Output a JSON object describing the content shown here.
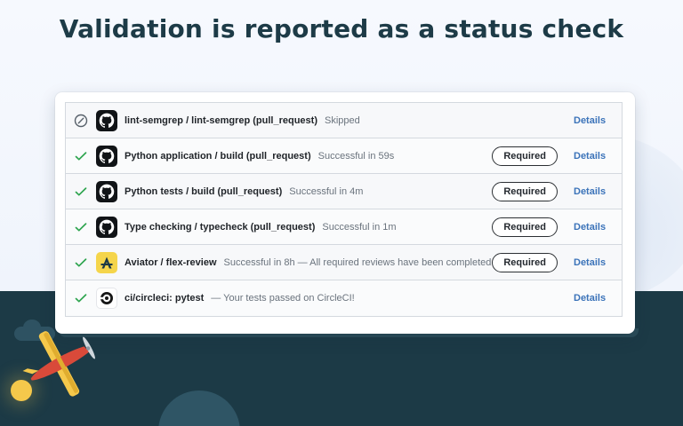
{
  "headline": "Validation is reported as a status check",
  "colors": {
    "dark_band": "#1c3a46",
    "success": "#2da44e",
    "link": "#3b73b9",
    "plane_yellow": "#f5c84b",
    "plane_red": "#d94a3a"
  },
  "checks": [
    {
      "status": "skipped",
      "status_icon": "skipped-icon",
      "avatar": "github-icon",
      "name": "lint-semgrep / lint-semgrep (pull_request)",
      "description": "Skipped",
      "required": "",
      "details": "Details"
    },
    {
      "status": "success",
      "status_icon": "check-icon",
      "avatar": "github-icon",
      "name": "Python application / build (pull_request)",
      "description": "Successful in 59s",
      "required": "Required",
      "details": "Details"
    },
    {
      "status": "success",
      "status_icon": "check-icon",
      "avatar": "github-icon",
      "name": "Python tests / build (pull_request)",
      "description": "Successful in 4m",
      "required": "Required",
      "details": "Details"
    },
    {
      "status": "success",
      "status_icon": "check-icon",
      "avatar": "github-icon",
      "name": "Type checking / typecheck (pull_request)",
      "description": "Successful in 1m",
      "required": "Required",
      "details": "Details"
    },
    {
      "status": "success",
      "status_icon": "check-icon",
      "avatar": "aviator-logo",
      "name": "Aviator / flex-review",
      "description": "Successful in 8h — All required reviews have been completed",
      "required": "Required",
      "details": "Details"
    },
    {
      "status": "success",
      "status_icon": "check-icon",
      "avatar": "circleci-logo",
      "name": "ci/circleci: pytest",
      "description": "— Your tests passed on CircleCI!",
      "required": "",
      "details": "Details"
    }
  ]
}
